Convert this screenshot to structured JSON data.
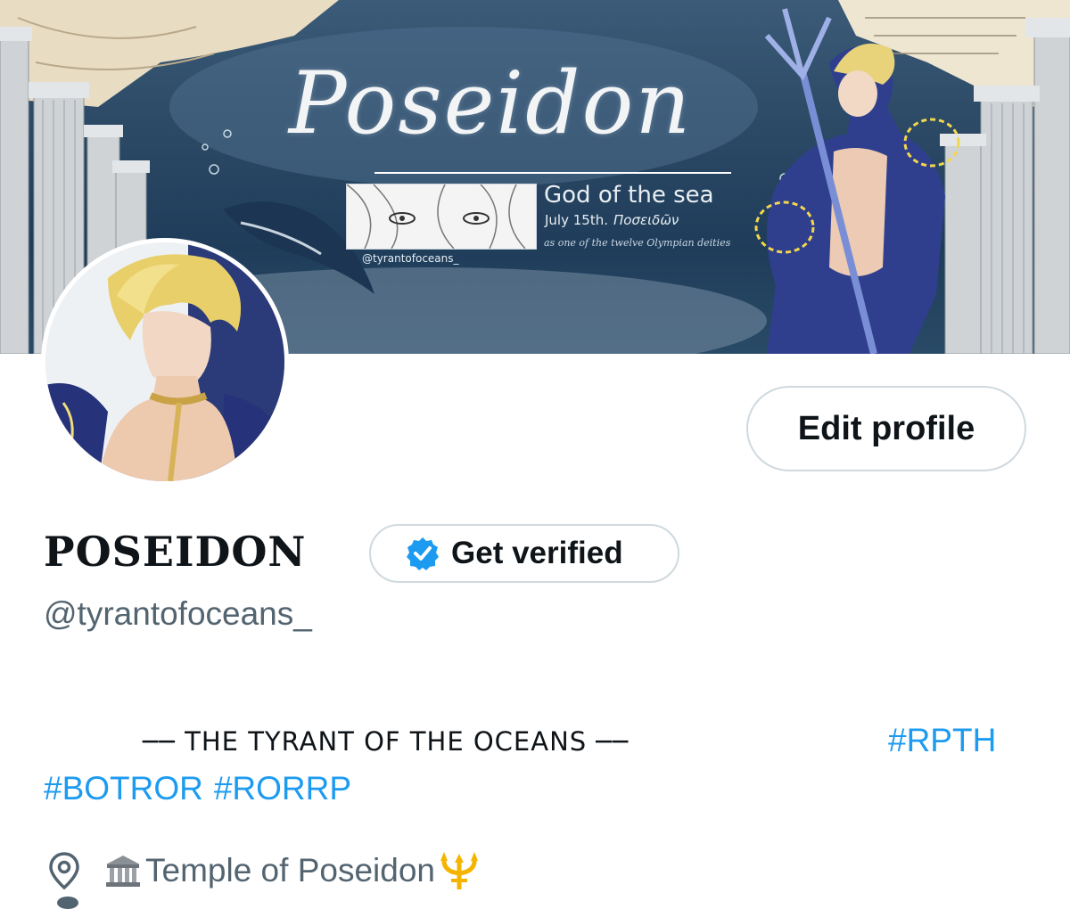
{
  "banner": {
    "title": "Poseidon",
    "subtitle": "God of the sea",
    "date": "July 15th.",
    "greek_name": "Ποσειδῶν",
    "deities_line": "as one of the twelve Olympian deities",
    "handle": "@tyrantofoceans_"
  },
  "profile": {
    "edit_label": "Edit profile",
    "display_name": "POSEIDON",
    "verify_label": "Get verified",
    "handle": "@tyrantofoceans_",
    "bio_line": "── THE TYRANT OF THE OCEANS ──",
    "tags": [
      "#RPTH",
      "#BOTROR",
      "#RORRP"
    ],
    "location": "Temple of Poseidon"
  },
  "icons": {
    "verified": "verified-badge-icon",
    "location": "location-pin-icon",
    "temple": "classical-building-icon",
    "trident": "trident-icon"
  },
  "colors": {
    "accent": "#1d9bf0",
    "text": "#0f1419",
    "muted": "#536471",
    "border": "#cfd9de",
    "trident": "#f5b400"
  }
}
